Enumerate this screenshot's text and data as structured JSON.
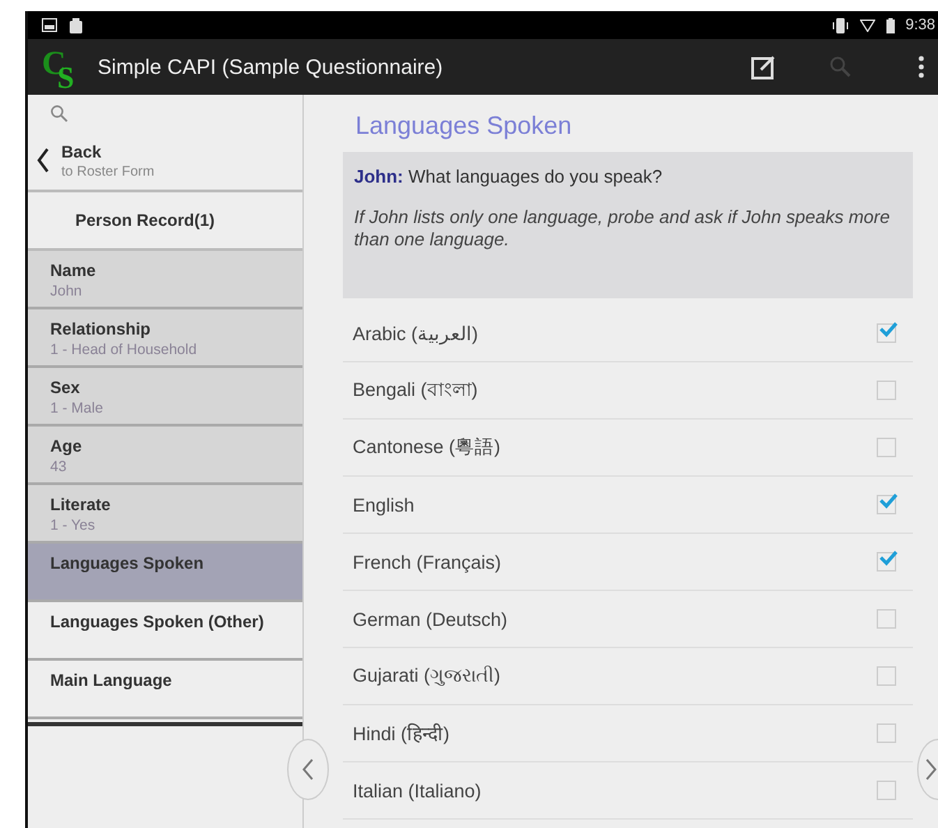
{
  "status_bar": {
    "time": "9:38"
  },
  "app_bar": {
    "title": "Simple CAPI (Sample Questionnaire)",
    "logo_letters": "CS"
  },
  "sidebar": {
    "back": {
      "label": "Back",
      "sub": "to Roster Form"
    },
    "group": "Person Record(1)",
    "items": [
      {
        "label": "Name",
        "value": "John",
        "answered": true,
        "selected": false
      },
      {
        "label": "Relationship",
        "value": "1 - Head of Household",
        "answered": true,
        "selected": false
      },
      {
        "label": "Sex",
        "value": "1 - Male",
        "answered": true,
        "selected": false
      },
      {
        "label": "Age",
        "value": "43",
        "answered": true,
        "selected": false
      },
      {
        "label": "Literate",
        "value": "1 - Yes",
        "answered": true,
        "selected": false
      },
      {
        "label": "Languages Spoken",
        "answered": false,
        "selected": true
      },
      {
        "label": "Languages Spoken (Other)",
        "answered": false,
        "selected": false
      },
      {
        "label": "Main Language",
        "answered": false,
        "selected": false
      }
    ]
  },
  "question": {
    "title": "Languages Spoken",
    "text": "**John:** What languages do you speak?",
    "help": "If John lists only one language, probe and ask if John speaks more than one language.",
    "options": [
      {
        "label": "Arabic (العربية)",
        "checked": true
      },
      {
        "label": "Bengali (বাংলা)",
        "checked": false
      },
      {
        "label": "Cantonese (粵語)",
        "checked": false
      },
      {
        "label": "English",
        "checked": true
      },
      {
        "label": "French (Français)",
        "checked": true
      },
      {
        "label": "German (Deutsch)",
        "checked": false
      },
      {
        "label": "Gujarati (ગુજરાતી)",
        "checked": false
      },
      {
        "label": "Hindi (हिन्दी)",
        "checked": false
      },
      {
        "label": "Italian (Italiano)",
        "checked": false
      }
    ]
  }
}
